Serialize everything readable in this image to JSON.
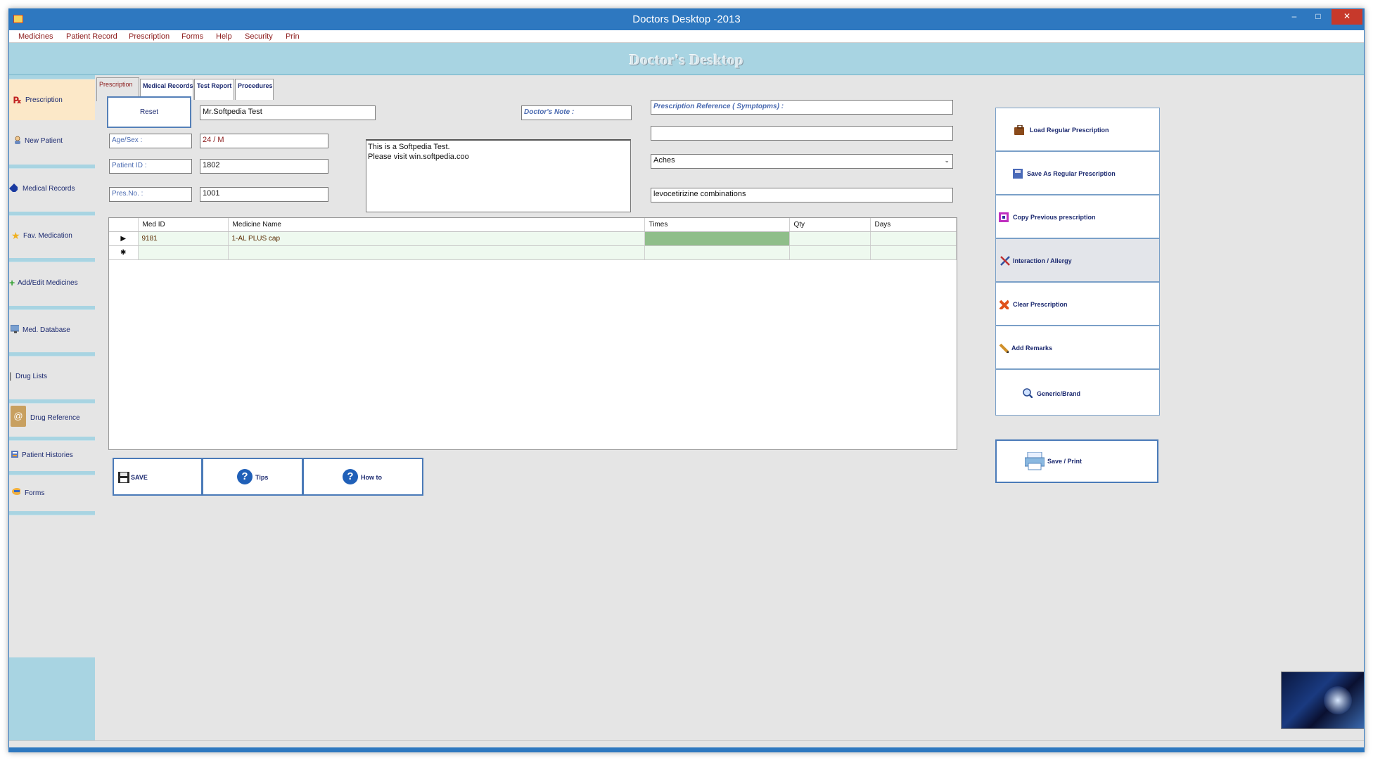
{
  "window": {
    "title": "Doctors Desktop -2013"
  },
  "menu": [
    "Medicines",
    "Patient Record",
    "Prescription",
    "Forms",
    "Help",
    "Security",
    "Prin"
  ],
  "banner": {
    "title": "Doctor's Desktop"
  },
  "sidebar": {
    "items": [
      {
        "label": "Prescription",
        "icon": "prescription-icon"
      },
      {
        "label": "New Patient",
        "icon": "patient-icon"
      },
      {
        "label": "Medical Records",
        "icon": "records-icon"
      },
      {
        "label": "Fav. Medication",
        "icon": "star-icon"
      },
      {
        "label": "Add/Edit  Medicines",
        "icon": "plus-icon"
      },
      {
        "label": "Med. Database",
        "icon": "monitor-icon"
      },
      {
        "label": "Drug Lists",
        "icon": "list-icon"
      },
      {
        "label": "Drug Reference",
        "icon": "at-icon"
      },
      {
        "label": "Patient Histories",
        "icon": "history-icon"
      },
      {
        "label": "Forms",
        "icon": "forms-icon"
      }
    ]
  },
  "tabs": [
    "Prescription",
    "Medical Records",
    "Test Report",
    "Procedures"
  ],
  "form": {
    "reset_label": "Reset",
    "patient_name": "Mr.Softpedia Test",
    "doctor_note_label": "Doctor's Note :",
    "age_sex_label": "Age/Sex :",
    "age_sex_value": "24 / M",
    "patient_id_label": "Patient ID :",
    "patient_id_value": "1802",
    "pres_no_label": "Pres.No. :",
    "pres_no_value": "1001",
    "notes_line1": "This is a Softpedia Test.",
    "notes_line2": "Please visit win.softpedia.coo",
    "prescription_reference_label": "Prescription Reference ( Symptopms)  :",
    "reference_empty": "",
    "symptom_selected": "Aches",
    "drug_note": "levocetirizine combinations"
  },
  "grid": {
    "columns": [
      "Med ID",
      "Medicine Name",
      "Times",
      "Qty",
      "Days"
    ],
    "rows": [
      {
        "marker": "▶",
        "med_id": "9181",
        "name": "1-AL PLUS cap",
        "times": "",
        "qty": "",
        "days": ""
      },
      {
        "marker": "✱",
        "med_id": "",
        "name": "",
        "times": "",
        "qty": "",
        "days": ""
      }
    ]
  },
  "bottom_buttons": {
    "save": "SAVE",
    "tips": "Tips",
    "howto": "How to"
  },
  "right_buttons": [
    "Load Regular Prescription",
    "Save As Regular Prescription",
    "Copy Previous prescription",
    "Interaction / Allergy",
    "Clear Prescription",
    "Add Remarks",
    "Generic/Brand"
  ],
  "save_print": "Save / Print",
  "colors": {
    "titlebar": "#2e78c0",
    "banner": "#a8d4e2",
    "menu_text": "#8b1a1a",
    "grid_selected": "#8fbe8a"
  }
}
